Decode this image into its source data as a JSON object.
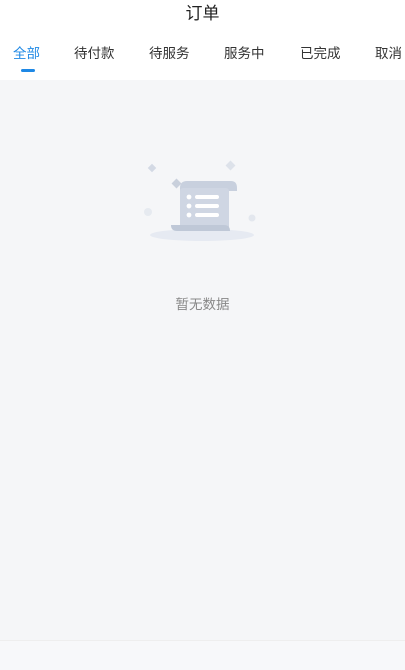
{
  "header": {
    "title": "订单"
  },
  "tabs": [
    {
      "label": "全部",
      "active": true
    },
    {
      "label": "待付款",
      "active": false
    },
    {
      "label": "待服务",
      "active": false
    },
    {
      "label": "服务中",
      "active": false
    },
    {
      "label": "已完成",
      "active": false
    },
    {
      "label": "取消",
      "active": false
    }
  ],
  "empty_state": {
    "text": "暂无数据",
    "icon": "document-list-icon"
  },
  "colors": {
    "accent": "#1e88e5",
    "background": "#f5f6f8",
    "text_primary": "#333333",
    "text_secondary": "#888888"
  }
}
